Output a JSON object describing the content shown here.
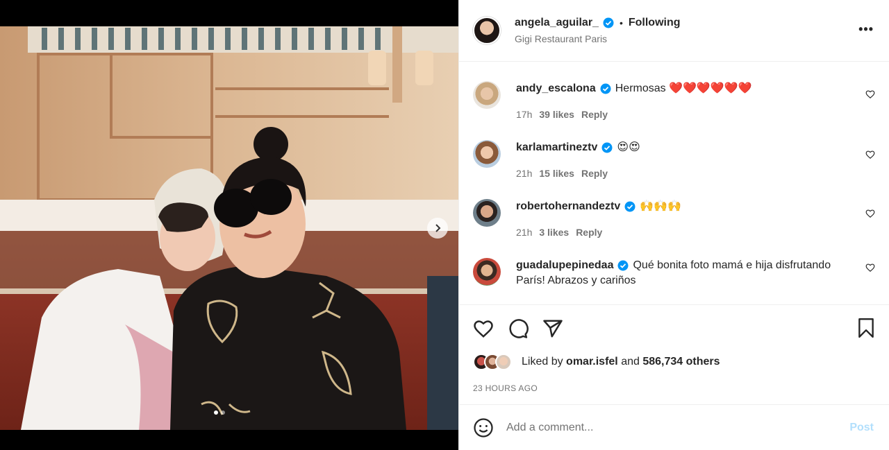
{
  "post": {
    "username": "angela_aguilar_",
    "separator": "•",
    "follow_status": "Following",
    "location": "Gigi Restaurant Paris",
    "more_icon": "more-horizontal-icon"
  },
  "comments": [
    {
      "username": "andy_escalona",
      "text": "Hermosas ❤️❤️❤️❤️❤️❤️",
      "time": "17h",
      "likes": "39 likes",
      "reply": "Reply"
    },
    {
      "username": "karlamartineztv",
      "text": "😍😍",
      "time": "21h",
      "likes": "15 likes",
      "reply": "Reply"
    },
    {
      "username": "robertohernandeztv",
      "text": "🙌🙌🙌",
      "time": "21h",
      "likes": "3 likes",
      "reply": "Reply"
    },
    {
      "username": "guadalupepinedaa",
      "text": "Qué bonita foto mamá e hija disfrutando París! Abrazos y cariños",
      "time": "",
      "likes": "",
      "reply": ""
    }
  ],
  "likes": {
    "prefix": "Liked by",
    "liker": "omar.isfel",
    "and": "and",
    "others": "586,734 others"
  },
  "timestamp": "23 HOURS AGO",
  "add_comment": {
    "placeholder": "Add a comment...",
    "post_label": "Post"
  },
  "colors": {
    "verified": "#0095f6",
    "text": "#262626",
    "secondary": "#737373",
    "post_disabled": "#b2dffc"
  }
}
